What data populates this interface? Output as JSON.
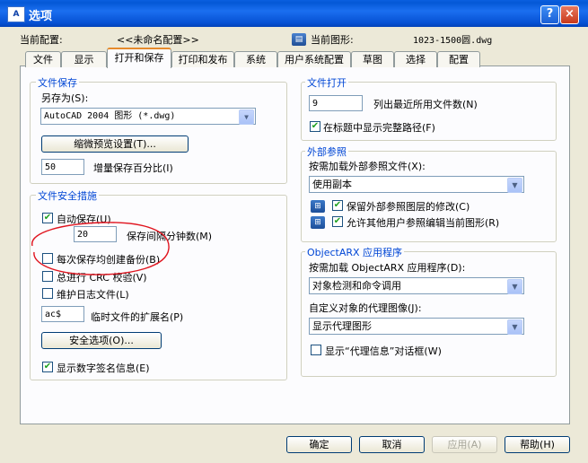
{
  "window": {
    "title": "选项",
    "help_glyph": "?",
    "close_glyph": "×",
    "app_icon_text": "A"
  },
  "profile": {
    "label": "当前配置:",
    "value": "<<未命名配置>>"
  },
  "drawing": {
    "label": "当前图形:",
    "value": "1023-1500圆.dwg"
  },
  "tabs": [
    "文件",
    "显示",
    "打开和保存",
    "打印和发布",
    "系统",
    "用户系统配置",
    "草图",
    "选择",
    "配置"
  ],
  "active_tab": "打开和保存",
  "file_save": {
    "title": "文件保存",
    "save_as_label": "另存为(S):",
    "save_as_value": "AutoCAD 2004 图形 (*.dwg)",
    "thumbnail_button": "缩微预览设置(T)...",
    "incremental_value": "50",
    "incremental_label": "增量保存百分比(I)"
  },
  "file_safety": {
    "title": "文件安全措施",
    "autosave_label": "自动保存(U)",
    "autosave_checked": true,
    "interval_value": "20",
    "interval_label": "保存间隔分钟数(M)",
    "backup_label": "每次保存均创建备份(B)",
    "backup_checked": false,
    "crc_label": "总进行 CRC 校验(V)",
    "crc_checked": false,
    "log_label": "维护日志文件(L)",
    "log_checked": false,
    "temp_ext_value": "ac$",
    "temp_ext_label": "临时文件的扩展名(P)",
    "security_button": "安全选项(O)...",
    "signature_label": "显示数字签名信息(E)",
    "signature_checked": true
  },
  "file_open": {
    "title": "文件打开",
    "recent_value": "9",
    "recent_label": "列出最近所用文件数(N)",
    "fullpath_label": "在标题中显示完整路径(F)",
    "fullpath_checked": true
  },
  "xref": {
    "title": "外部参照",
    "demand_label": "按需加载外部参照文件(X):",
    "demand_value": "使用副本",
    "retain_label": "保留外部参照图层的修改(C)",
    "retain_checked": true,
    "allow_label": "允许其他用户参照编辑当前图形(R)",
    "allow_checked": true
  },
  "objectarx": {
    "title": "ObjectARX 应用程序",
    "demand_label": "按需加载 ObjectARX 应用程序(D):",
    "demand_value": "对象检测和命令调用",
    "proxy_label": "自定义对象的代理图像(J):",
    "proxy_value": "显示代理图形",
    "proxy_info_label": "显示“代理信息”对话框(W)",
    "proxy_info_checked": false
  },
  "footer": {
    "ok": "确定",
    "cancel": "取消",
    "apply": "应用(A)",
    "help": "帮助(H)"
  },
  "colors": {
    "titlebar": "#0458d6",
    "group_title": "#0046d5",
    "annotation": "#e0141e"
  }
}
